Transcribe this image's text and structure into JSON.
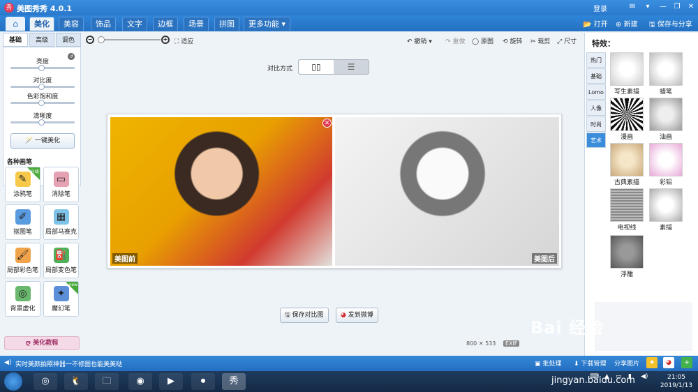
{
  "window": {
    "title": "美图秀秀 4.0.1",
    "login": "登录",
    "logo_char": "秀"
  },
  "nav": {
    "home_icon": "home-icon",
    "tabs": [
      "美化",
      "美容",
      "饰品",
      "文字",
      "边框",
      "场景",
      "拼图",
      "更多功能"
    ],
    "active_tab": "美化",
    "open": "打开",
    "new": "新建",
    "save_share": "保存与分享"
  },
  "left": {
    "subtabs": [
      "基础",
      "高级",
      "调色"
    ],
    "sliders": [
      {
        "label": "亮度",
        "value": 0.5
      },
      {
        "label": "对比度",
        "value": 0.5
      },
      {
        "label": "色彩饱和度",
        "value": 0.5
      },
      {
        "label": "清晰度",
        "value": 0.5
      }
    ],
    "one_click": "一键美化",
    "brushes_title": "各种画笔",
    "brushes": [
      {
        "label": "涂鸦笔",
        "badge": "升级",
        "color": "#f6c94a"
      },
      {
        "label": "消除笔",
        "badge": "",
        "color": "#e5a2b3"
      },
      {
        "label": "抠图笔",
        "badge": "",
        "color": "#5a9be0"
      },
      {
        "label": "局部马赛克",
        "badge": "",
        "color": "#7fc3e8"
      },
      {
        "label": "局部彩色笔",
        "badge": "",
        "color": "#f0a34a"
      },
      {
        "label": "局部变色笔",
        "badge": "",
        "color": "#4fb05a"
      },
      {
        "label": "背景虚化",
        "badge": "",
        "color": "#6ab86e"
      },
      {
        "label": "魔幻笔",
        "badge": "new",
        "color": "#5d8fd9"
      }
    ],
    "tutorial": "美化教程"
  },
  "toolbar": {
    "fit": "适应",
    "undo": "撤销",
    "redo": "重做",
    "original": "原图",
    "rotate": "旋转",
    "crop": "裁剪",
    "resize": "尺寸"
  },
  "compare": {
    "label": "对比方式"
  },
  "canvas": {
    "before": "美图前",
    "after": "美图后"
  },
  "actions": {
    "save_compare": "保存对比图",
    "send_weibo": "发到微博"
  },
  "image_size": {
    "width": 800,
    "height": 533,
    "exif": "EXIF"
  },
  "effects": {
    "title": "特效：",
    "categories": [
      "热门",
      "基础",
      "Lomo",
      "人像",
      "时尚",
      "艺术"
    ],
    "active_category": "艺术",
    "items": [
      "写生素描",
      "蜡笔",
      "漫画",
      "油画",
      "古典素描",
      "彩铅",
      "电视线",
      "素描",
      "浮雕"
    ]
  },
  "status": {
    "tip": "实时美颜拍照神器一不修图也能美美哒",
    "batch": "批处理",
    "download": "下载管理",
    "share": "分享图片"
  },
  "taskbar": {
    "time": "21:05",
    "date": "2019/1/13"
  },
  "watermark": {
    "brand": "Bai 经验",
    "url": "jingyan.baidu.com"
  },
  "colors": {
    "accent": "#2a78cc",
    "active_category": "#3b8ddc",
    "close": "#e0394f"
  }
}
